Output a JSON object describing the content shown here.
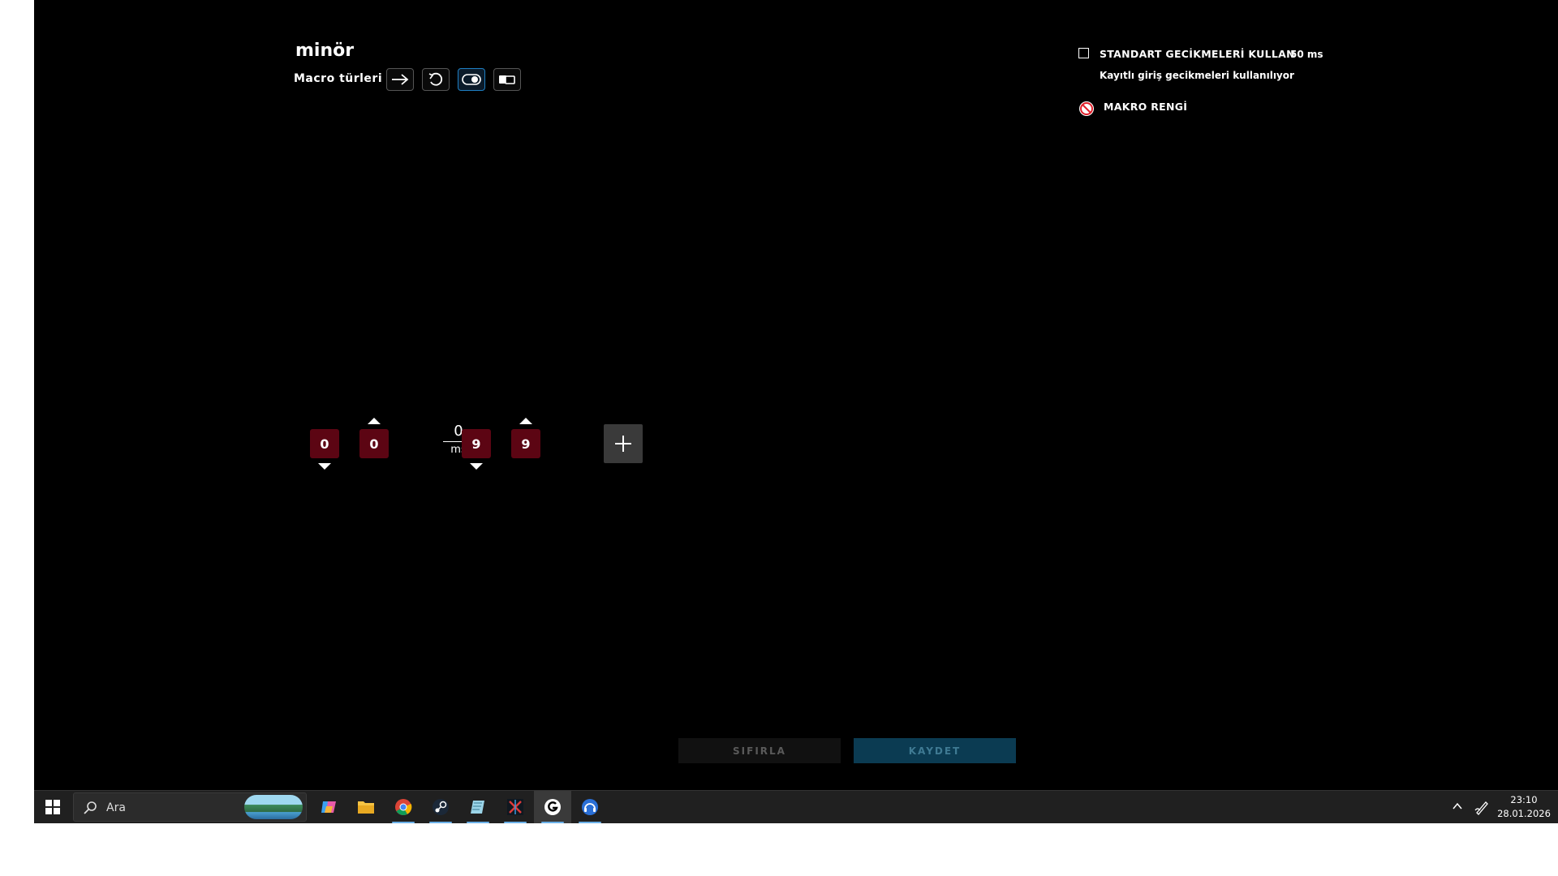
{
  "macro": {
    "title": "minör",
    "types_label": "Macro türleri",
    "types": [
      {
        "icon": "arrow-right-icon",
        "active": false
      },
      {
        "icon": "repeat-icon",
        "active": false
      },
      {
        "icon": "toggle-icon",
        "active": true
      },
      {
        "icon": "sequence-icon",
        "active": false
      }
    ]
  },
  "options": {
    "use_default_delays_label": "STANDART GECİKMELERİ KULLAN",
    "default_delay": "50 ms",
    "recorded_delays_note": "Kayıtlı giriş gecikmeleri kullanılıyor",
    "macro_color_label": "MAKRO RENGİ",
    "use_default_delays_checked": false
  },
  "sequence": {
    "keys": [
      {
        "label": "0",
        "direction": "down"
      },
      {
        "label": "0",
        "direction": "up"
      },
      {
        "label": "9",
        "direction": "down"
      },
      {
        "label": "9",
        "direction": "up"
      }
    ],
    "delay": {
      "value": "0",
      "unit": "ms"
    },
    "key_color": "#5c0513"
  },
  "footer": {
    "reset_label": "SIFIRLA",
    "save_label": "KAYDET"
  },
  "taskbar": {
    "search_placeholder": "Ara",
    "apps": [
      "copilot-icon",
      "file-explorer-icon",
      "chrome-icon",
      "steam-icon",
      "notes-icon",
      "game-icon",
      "logitech-ghub-icon",
      "headset-app-icon"
    ],
    "time": "23:10",
    "date": "28.01.2026"
  }
}
